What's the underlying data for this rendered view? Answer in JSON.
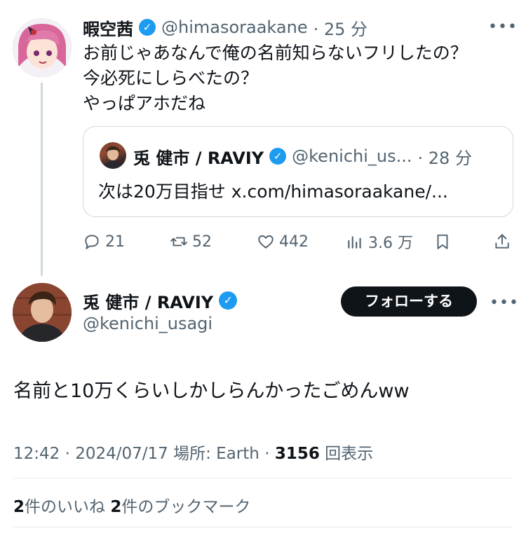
{
  "reply_tweet": {
    "display_name": "暇空茜",
    "handle": "@himasoraakane",
    "time": "· 25 分",
    "lines": [
      "お前じゃあなんで俺の名前知らないフリしたの？",
      "今必死にしらべたの？",
      "やっぱアホだね"
    ],
    "more": "•••"
  },
  "quoted_tweet": {
    "display_name": "兎 健市 / RAVIY",
    "handle": "@kenichi_us...",
    "time": "· 28 分",
    "text": "次は20万目指せ x.com/himasoraakane/..."
  },
  "actions": {
    "replies": "21",
    "retweets": "52",
    "likes": "442",
    "views": "3.6 万"
  },
  "main_tweet": {
    "display_name": "兎 健市 / RAVIY",
    "handle": "@kenichi_usagi",
    "follow_label": "フォローする",
    "text": "名前と10万くらいしかしらんかったごめんww",
    "time": "12:42",
    "date": "2024/07/17",
    "location": "場所: Earth",
    "views_count": "3156",
    "views_label": "回表示",
    "likes_count": "2",
    "likes_label": "件のいいね",
    "bookmarks_count": "2",
    "bookmarks_label": "件のブックマーク",
    "more": "•••"
  },
  "colors": {
    "verified": "#1d9bf0",
    "text": "#0f1419",
    "secondary": "#536471",
    "button": "#0f1419"
  },
  "icons": [
    "verified-badge-icon",
    "reply-icon",
    "retweet-icon",
    "like-icon",
    "views-icon",
    "bookmark-icon",
    "share-icon",
    "more-icon"
  ]
}
